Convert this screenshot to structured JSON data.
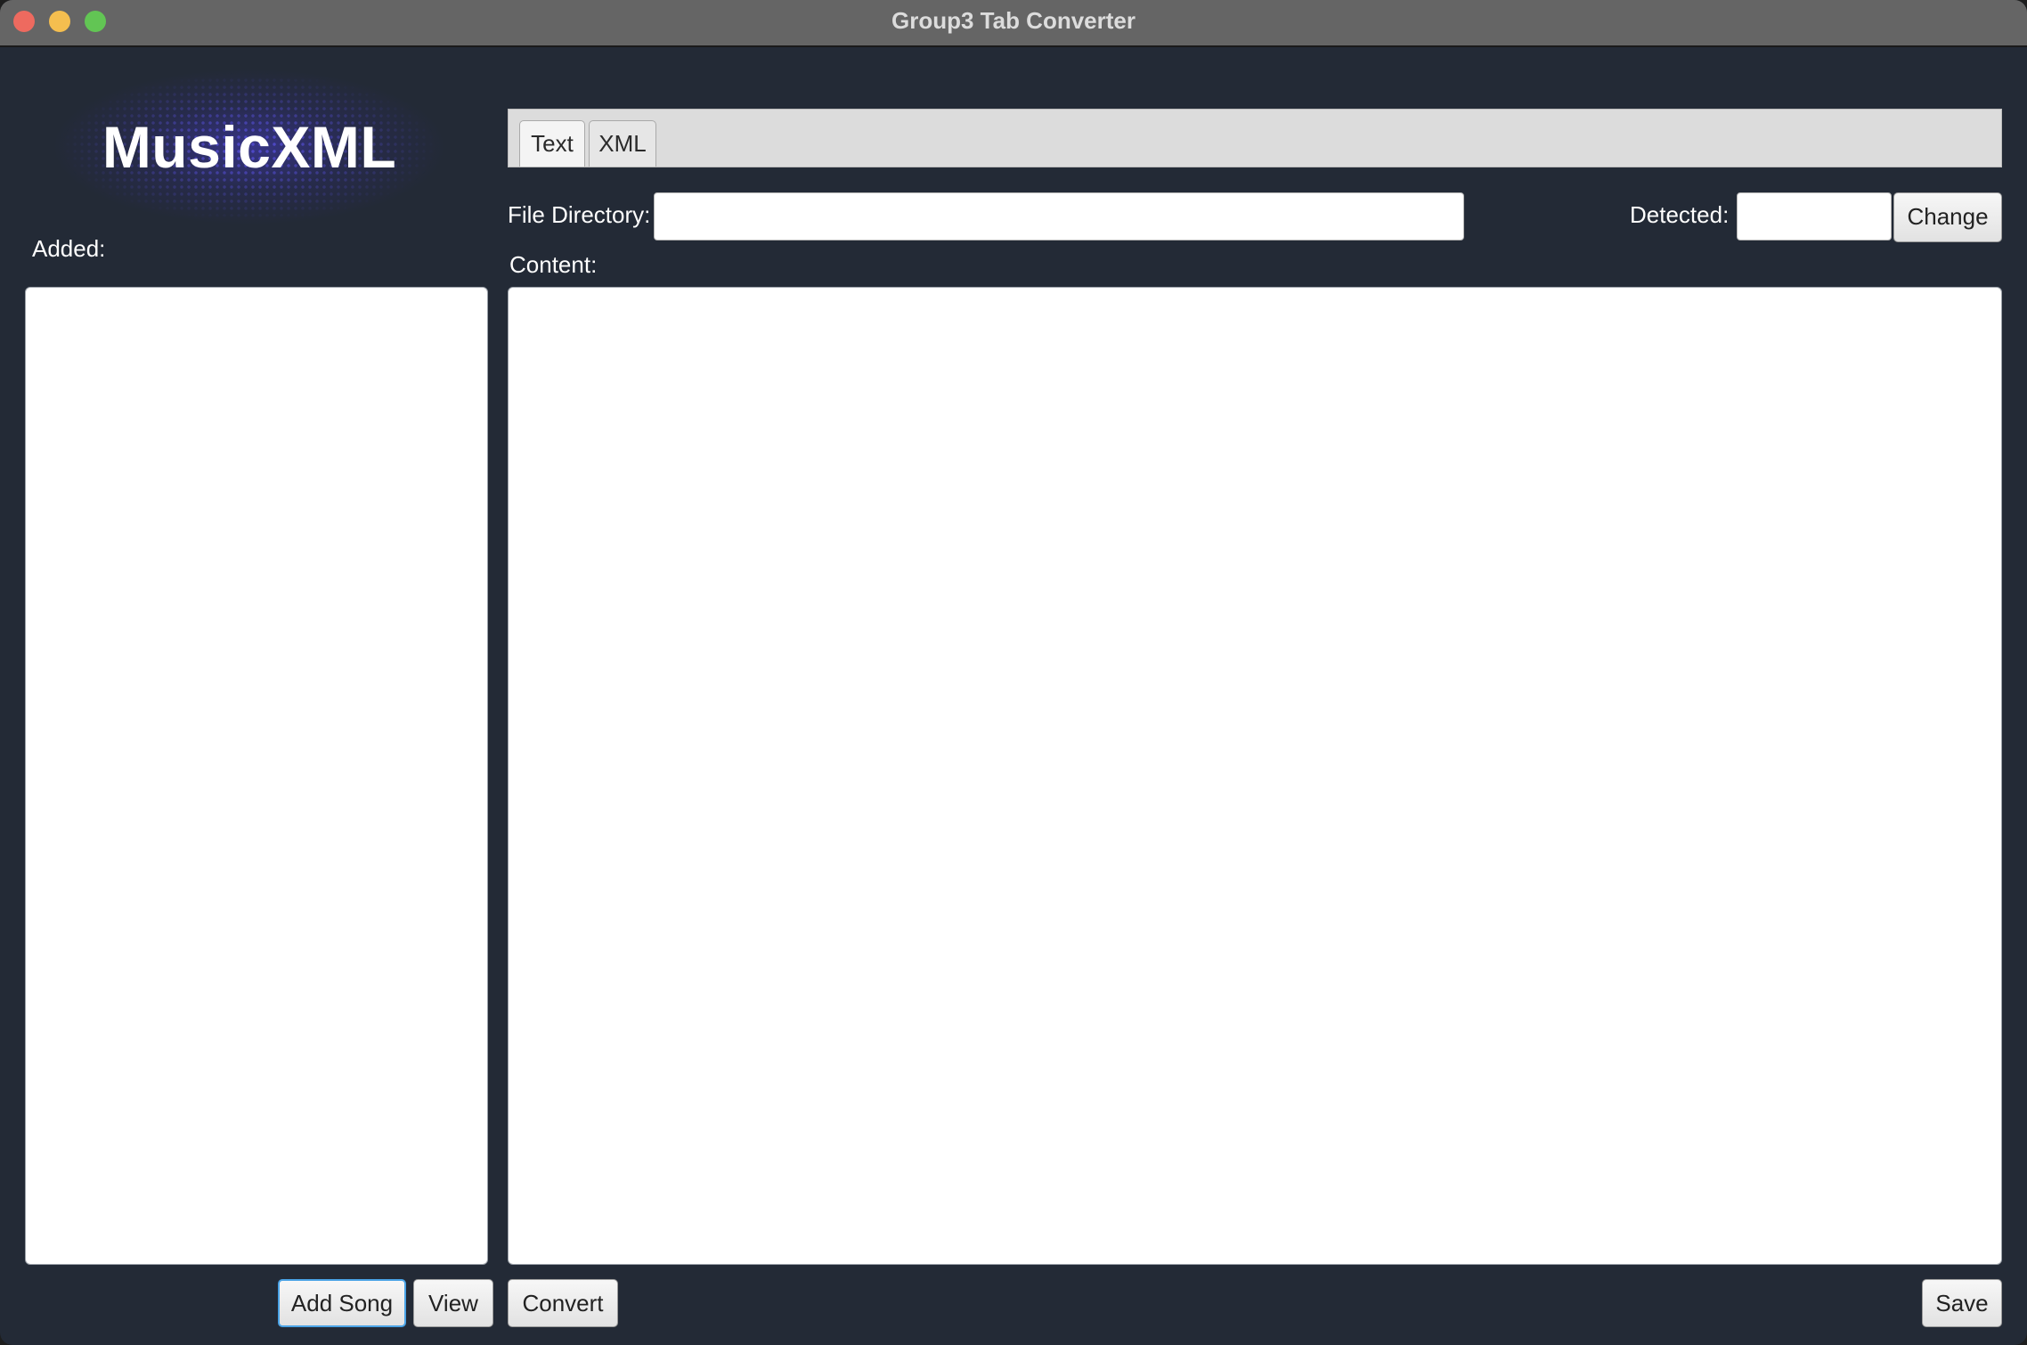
{
  "window": {
    "title": "Group3 Tab Converter"
  },
  "logo": {
    "text": "MusicXML"
  },
  "sidebar": {
    "added_label": "Added:",
    "added_items": [],
    "add_song_label": "Add Song",
    "view_label": "View"
  },
  "tabs": [
    {
      "label": "Text",
      "active": true
    },
    {
      "label": "XML",
      "active": false
    }
  ],
  "file_directory": {
    "label": "File Directory:",
    "value": ""
  },
  "detected": {
    "label": "Detected:",
    "value": "",
    "change_label": "Change"
  },
  "content": {
    "label": "Content:",
    "value": ""
  },
  "actions": {
    "convert_label": "Convert",
    "save_label": "Save"
  },
  "colors": {
    "window_bg": "#232a36",
    "titlebar_bg": "#656565",
    "focus_ring": "#4aa3e6"
  }
}
